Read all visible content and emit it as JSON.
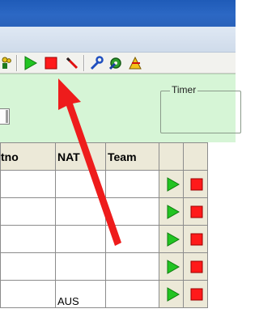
{
  "colors": {
    "title_blue": "#2a62bb",
    "panel_green": "#d6f5d6",
    "play_green": "#1fbf1f",
    "stop_red": "#ff1a1a",
    "arrow_red": "#ee1c1c"
  },
  "toolbar": {
    "icons": [
      "people-icon",
      "play-icon",
      "stop-icon",
      "wand-icon",
      "wrench-icon",
      "gear-icon",
      "tools-icon"
    ]
  },
  "panel": {
    "timer_label": "Timer"
  },
  "grid": {
    "headers": [
      "tno",
      "NAT",
      "Team"
    ],
    "rows": [
      {
        "tno": "",
        "nat": "",
        "team": ""
      },
      {
        "tno": "",
        "nat": "",
        "team": ""
      },
      {
        "tno": "",
        "nat": "",
        "team": ""
      },
      {
        "tno": "",
        "nat": "",
        "team": ""
      },
      {
        "tno": "",
        "nat": "AUS",
        "team": ""
      }
    ]
  }
}
